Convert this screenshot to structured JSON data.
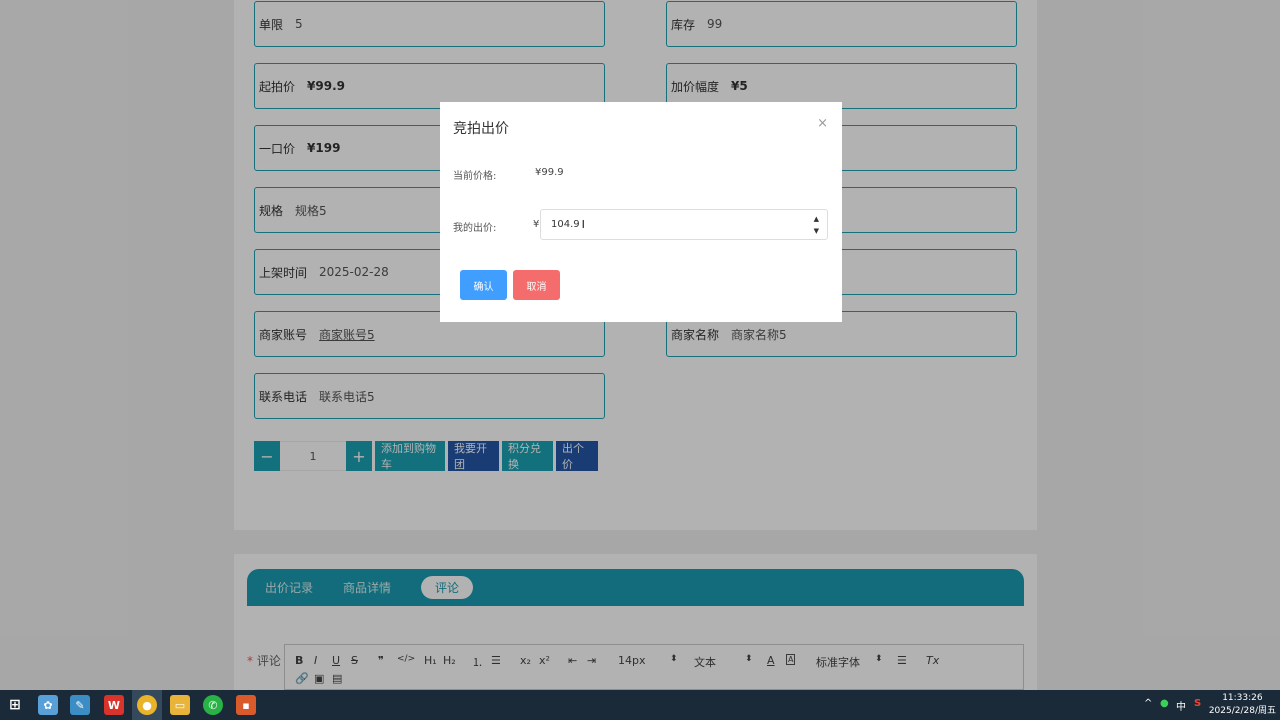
{
  "fields": [
    {
      "label": "单限",
      "value": "5"
    },
    {
      "label": "库存",
      "value": "99"
    },
    {
      "label": "起拍价",
      "value": "¥99.9"
    },
    {
      "label": "加价幅度",
      "value": "¥5"
    },
    {
      "label": "一口价",
      "value": "¥199"
    },
    {
      "label": "规格",
      "value": "规格5"
    },
    {
      "label": "上架时间",
      "value": "2025-02-28"
    },
    {
      "label": "商家账号",
      "value": "商家账号5"
    },
    {
      "label": "商家名称",
      "value": "商家名称5"
    },
    {
      "label": "联系电话",
      "value": "联系电话5"
    }
  ],
  "actions": {
    "minus": "−",
    "quantity": "1",
    "plus": "+",
    "add_cart": "添加到购物车",
    "group_buy": "我要开团",
    "points": "积分兑换",
    "bid": "出个价"
  },
  "tabs": [
    "出价记录",
    "商品详情",
    "评论"
  ],
  "review": {
    "label": "评论",
    "toolbar": {
      "b": "B",
      "i": "I",
      "u": "U",
      "s": "S",
      "quote": "❞",
      "code": "</>",
      "h1": "H₁",
      "h2": "H₂",
      "ol": "⒈",
      "ul": "☰",
      "sub": "x₂",
      "sup": "x²",
      "indent_l": "⇤",
      "indent_r": "⇥",
      "size": "14px",
      "heading": "文本",
      "font_color": "A",
      "bg_color": "A",
      "font": "标准字体",
      "align": "☰",
      "clear": "Tx"
    }
  },
  "modal": {
    "title": "竞拍出价",
    "close": "×",
    "current_label": "当前价格:",
    "current_value": "¥99.9",
    "bid_label": "我的出价:",
    "yen": "¥",
    "bid_value": "104.9",
    "confirm": "确认",
    "cancel": "取消"
  },
  "taskbar": {
    "tray_ime": "中",
    "time": "11:33:26",
    "date": "2025/2/28/周五"
  },
  "colors": {
    "teal": "#1aa3b3",
    "navy": "#2456a6",
    "confirm": "#409eff",
    "cancel": "#f56c6c"
  }
}
